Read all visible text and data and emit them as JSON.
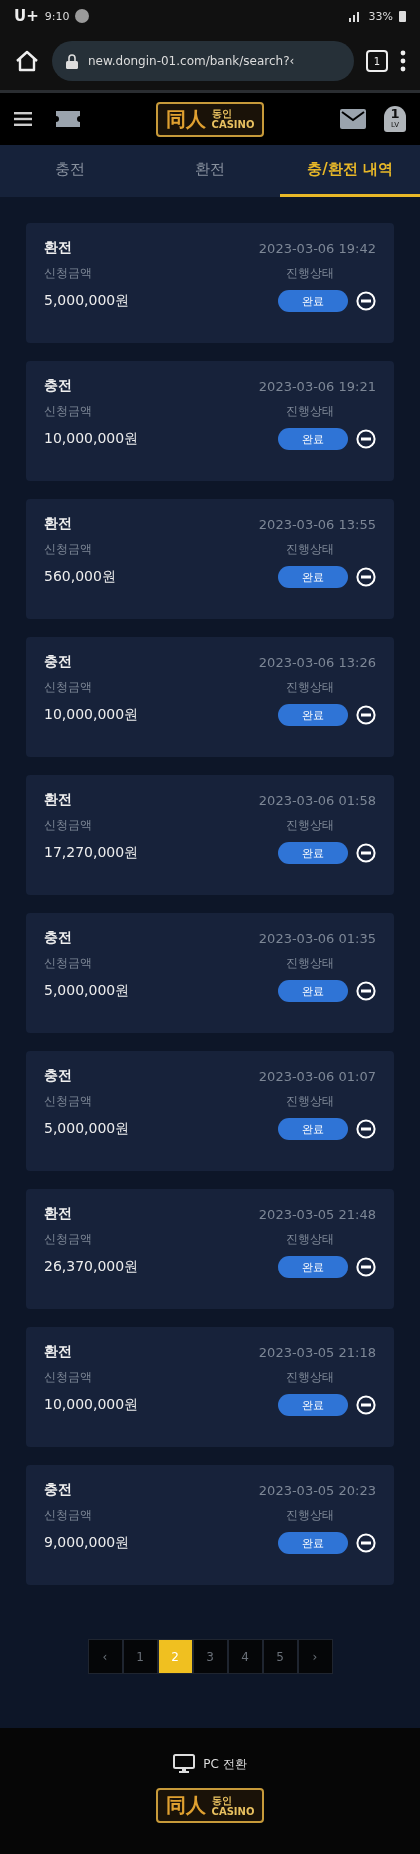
{
  "status_bar": {
    "carrier": "U+",
    "time": "9:10",
    "battery": "33%"
  },
  "browser": {
    "url": "new.dongin-01.com/bank/search?‹",
    "tab_count": "1"
  },
  "header": {
    "logo": {
      "mark": "同人",
      "name": "동인",
      "sub": "CASINO"
    },
    "level": "1",
    "level_label": "LV"
  },
  "tabs": [
    {
      "label": "충전",
      "selected": false
    },
    {
      "label": "환전",
      "selected": false
    },
    {
      "label": "충/환전 내역",
      "selected": true
    }
  ],
  "records": [
    {
      "type": "환전",
      "date": "2023-03-06 19:42",
      "amount_label": "신청금액",
      "amount": "5,000,000원",
      "status_label": "진행상태",
      "status": "완료"
    },
    {
      "type": "충전",
      "date": "2023-03-06 19:21",
      "amount_label": "신청금액",
      "amount": "10,000,000원",
      "status_label": "진행상태",
      "status": "완료"
    },
    {
      "type": "환전",
      "date": "2023-03-06 13:55",
      "amount_label": "신청금액",
      "amount": "560,000원",
      "status_label": "진행상태",
      "status": "완료"
    },
    {
      "type": "충전",
      "date": "2023-03-06 13:26",
      "amount_label": "신청금액",
      "amount": "10,000,000원",
      "status_label": "진행상태",
      "status": "완료"
    },
    {
      "type": "환전",
      "date": "2023-03-06 01:58",
      "amount_label": "신청금액",
      "amount": "17,270,000원",
      "status_label": "진행상태",
      "status": "완료"
    },
    {
      "type": "충전",
      "date": "2023-03-06 01:35",
      "amount_label": "신청금액",
      "amount": "5,000,000원",
      "status_label": "진행상태",
      "status": "완료"
    },
    {
      "type": "충전",
      "date": "2023-03-06 01:07",
      "amount_label": "신청금액",
      "amount": "5,000,000원",
      "status_label": "진행상태",
      "status": "완료"
    },
    {
      "type": "환전",
      "date": "2023-03-05 21:48",
      "amount_label": "신청금액",
      "amount": "26,370,000원",
      "status_label": "진행상태",
      "status": "완료"
    },
    {
      "type": "환전",
      "date": "2023-03-05 21:18",
      "amount_label": "신청금액",
      "amount": "10,000,000원",
      "status_label": "진행상태",
      "status": "완료"
    },
    {
      "type": "충전",
      "date": "2023-03-05 20:23",
      "amount_label": "신청금액",
      "amount": "9,000,000원",
      "status_label": "진행상태",
      "status": "완료"
    }
  ],
  "pagination": {
    "prev": "‹",
    "next": "›",
    "pages": [
      {
        "label": "1",
        "selected": false
      },
      {
        "label": "2",
        "selected": true
      },
      {
        "label": "3",
        "selected": false
      },
      {
        "label": "4",
        "selected": false
      },
      {
        "label": "5",
        "selected": false
      }
    ]
  },
  "footer": {
    "pc_switch": "PC 전환",
    "logo": {
      "mark": "同人",
      "name": "동인",
      "sub": "CASINO"
    }
  }
}
